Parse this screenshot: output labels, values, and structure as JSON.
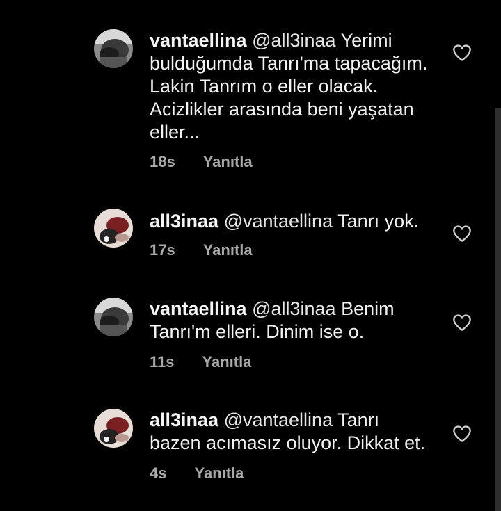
{
  "comments": [
    {
      "username": "vantaellina",
      "mention": "@all3inaa",
      "text": " Yerimi bulduğumda Tanrı'ma tapacağım. Lakin Tanrım o eller olacak. Acizlikler arasında beni yaşatan eller...",
      "time": "18s",
      "reply_label": "Yanıtla",
      "avatar": "avatar-vantaellina"
    },
    {
      "username": "all3inaa",
      "mention": "@vantaellina",
      "text": " Tanrı yok.",
      "time": "17s",
      "reply_label": "Yanıtla",
      "avatar": "avatar-all3inaa"
    },
    {
      "username": "vantaellina",
      "mention": "@all3inaa",
      "text": " Benim Tanrı'm elleri. Dinim ise o.",
      "time": "11s",
      "reply_label": "Yanıtla",
      "avatar": "avatar-vantaellina"
    },
    {
      "username": "all3inaa",
      "mention": "@vantaellina",
      "text": " Tanrı bazen acımasız oluyor. Dikkat et.",
      "time": "4s",
      "reply_label": "Yanıtla",
      "avatar": "avatar-all3inaa"
    }
  ],
  "icons": {
    "like": "heart-outline-icon"
  },
  "colors": {
    "background": "#000000",
    "text": "#f5f5f5",
    "meta": "#a8a8a8"
  }
}
